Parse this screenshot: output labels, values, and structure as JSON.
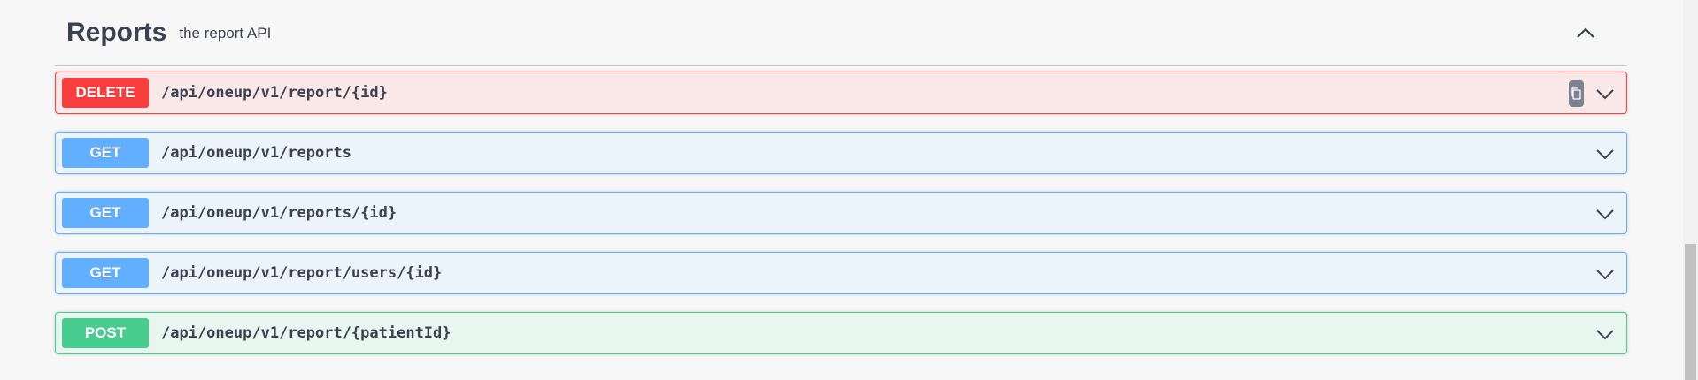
{
  "section": {
    "title": "Reports",
    "description": "the report API"
  },
  "operations": [
    {
      "method": "DELETE",
      "path": "/api/oneup/v1/report/{id}"
    },
    {
      "method": "GET",
      "path": "/api/oneup/v1/reports"
    },
    {
      "method": "GET",
      "path": "/api/oneup/v1/reports/{id}"
    },
    {
      "method": "GET",
      "path": "/api/oneup/v1/report/users/{id}"
    },
    {
      "method": "POST",
      "path": "/api/oneup/v1/report/{patientId}"
    }
  ],
  "colors": {
    "delete": "#f93e3e",
    "get": "#61affe",
    "post": "#49cc90",
    "text": "#3b4151"
  },
  "icons": {
    "collapse": "chevron-up-icon",
    "expand": "chevron-down-icon",
    "copy": "copy-icon"
  }
}
